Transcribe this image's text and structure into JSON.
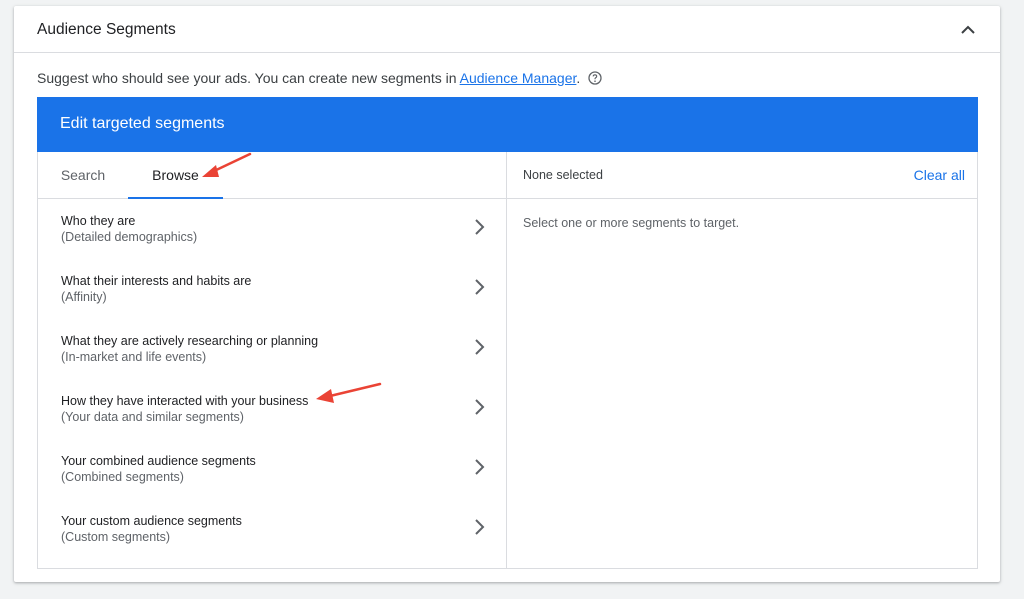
{
  "card": {
    "title": "Audience Segments",
    "collapse_icon": "chevron-up-icon"
  },
  "suggest": {
    "text": "Suggest who should see your ads.  You can create new segments in ",
    "link": "Audience Manager",
    "after": ".",
    "help_icon": "help-circle-icon"
  },
  "editor": {
    "title": "Edit targeted segments",
    "tabs": [
      {
        "label": "Search",
        "active": false
      },
      {
        "label": "Browse",
        "active": true
      }
    ],
    "segments": [
      {
        "title": "Who they are",
        "subtitle": "(Detailed demographics)"
      },
      {
        "title": "What their interests and habits are",
        "subtitle": "(Affinity)"
      },
      {
        "title": "What they are actively researching or planning",
        "subtitle": "(In-market and life events)"
      },
      {
        "title": "How they have interacted with your business",
        "subtitle": "(Your data and similar segments)"
      },
      {
        "title": "Your combined audience segments",
        "subtitle": "(Combined segments)"
      },
      {
        "title": "Your custom audience segments",
        "subtitle": "(Custom segments)"
      }
    ],
    "selection": {
      "status": "None selected",
      "clear_label": "Clear all",
      "hint": "Select one or more segments to target."
    }
  },
  "colors": {
    "accent": "#1a73e8",
    "annotation_arrow": "#ea4335"
  }
}
